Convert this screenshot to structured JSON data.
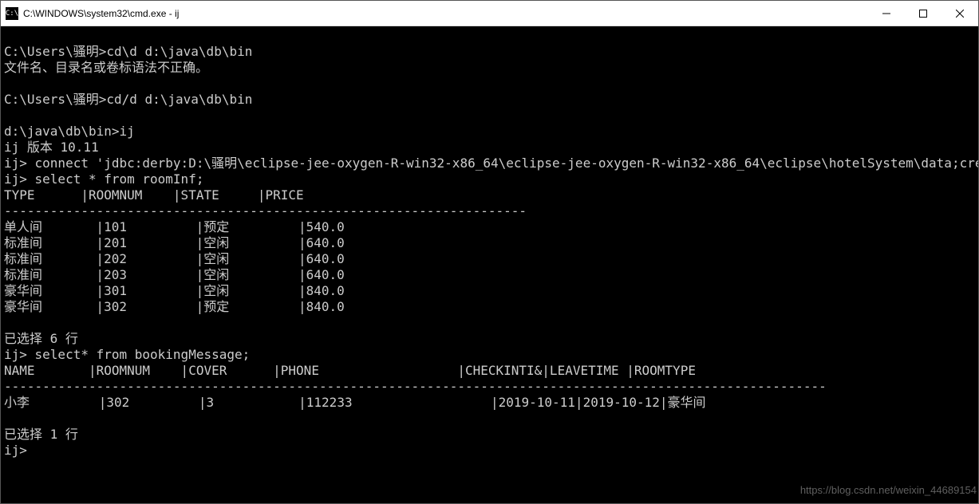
{
  "window": {
    "icon_label": "C:\\",
    "title": "C:\\WINDOWS\\system32\\cmd.exe - ij"
  },
  "terminal": {
    "prompt1": "C:\\Users\\骚明>cd\\d d:\\java\\db\\bin",
    "error1": "文件名、目录名或卷标语法不正确。",
    "blank1": "",
    "prompt2": "C:\\Users\\骚明>cd/d d:\\java\\db\\bin",
    "blank2": "",
    "prompt3": "d:\\java\\db\\bin>ij",
    "version": "ij 版本 10.11",
    "connect": "ij> connect 'jdbc:derby:D:\\骚明\\eclipse-jee-oxygen-R-win32-x86_64\\eclipse-jee-oxygen-R-win32-x86_64\\eclipse\\hotelSystem\\data;create=false';",
    "select1": "ij> select * from roomInf;",
    "header1": "TYPE      |ROOMNUM    |STATE     |PRICE",
    "divider1": "--------------------------------------------------------------------",
    "row1": "单人间       |101         |预定         |540.0",
    "row2": "标准间       |201         |空闲         |640.0",
    "row3": "标准间       |202         |空闲         |640.0",
    "row4": "标准间       |203         |空闲         |640.0",
    "row5": "豪华间       |301         |空闲         |840.0",
    "row6": "豪华间       |302         |预定         |840.0",
    "blank3": "",
    "selected1": "已选择 6 行",
    "select2": "ij> select* from bookingMessage;",
    "header2": "NAME       |ROOMNUM    |COVER      |PHONE                  |CHECKINTI&|LEAVETIME |ROOMTYPE",
    "divider2": "-----------------------------------------------------------------------------------------------------------",
    "brow1": "小李         |302         |3           |112233                  |2019-10-11|2019-10-12|豪华间",
    "blank4": "",
    "selected2": "已选择 1 行",
    "finalprompt": "ij>"
  },
  "watermark": "https://blog.csdn.net/weixin_44689154"
}
